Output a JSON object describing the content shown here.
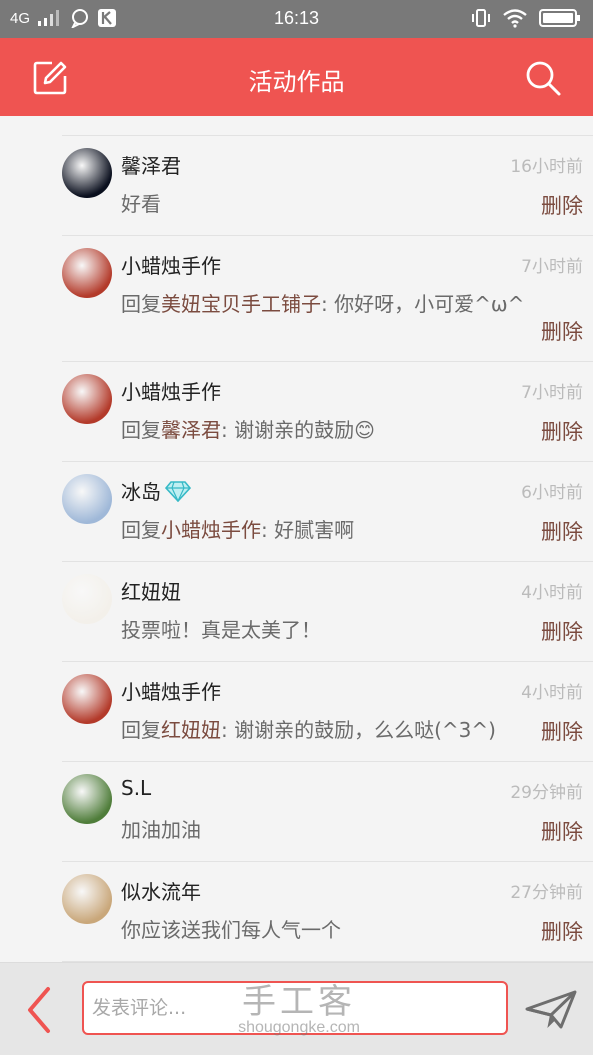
{
  "status_bar": {
    "network": "4G",
    "time": "16:13"
  },
  "header": {
    "title": "活动作品",
    "edit_icon": "edit-square-icon",
    "search_icon": "search-icon",
    "background": "#ef5451"
  },
  "comments": [
    {
      "name": "馨泽君",
      "badge": "",
      "time": "16小时前",
      "prefix": "",
      "mention": "",
      "text": "好看",
      "delete": "删除",
      "avatar_color": "#0a0f1e"
    },
    {
      "name": "小蜡烛手作",
      "badge": "",
      "time": "7小时前",
      "prefix": "回复",
      "mention": "美妞宝贝手工铺子",
      "text": ": 你好呀，小可爱^ω^",
      "delete": "删除",
      "avatar_color": "#b33a2a"
    },
    {
      "name": "小蜡烛手作",
      "badge": "",
      "time": "7小时前",
      "prefix": "回复",
      "mention": "馨泽君",
      "text": ": 谢谢亲的鼓励😊",
      "delete": "删除",
      "avatar_color": "#b33a2a"
    },
    {
      "name": "冰岛",
      "badge": "diamond-icon",
      "time": "6小时前",
      "prefix": "回复",
      "mention": "小蜡烛手作",
      "text": ": 好腻害啊",
      "delete": "删除",
      "avatar_color": "#9fb8d8"
    },
    {
      "name": "红妞妞",
      "badge": "",
      "time": "4小时前",
      "prefix": "",
      "mention": "",
      "text": "投票啦！真是太美了！",
      "delete": "删除",
      "avatar_color": "#f3f0ea"
    },
    {
      "name": "小蜡烛手作",
      "badge": "",
      "time": "4小时前",
      "prefix": "回复",
      "mention": "红妞妞",
      "text": ": 谢谢亲的鼓励，么么哒(^3^)",
      "delete": "删除",
      "avatar_color": "#b33a2a"
    },
    {
      "name": "S.L",
      "badge": "",
      "time": "29分钟前",
      "prefix": "",
      "mention": "",
      "text": "加油加油",
      "delete": "删除",
      "avatar_color": "#4f7d3a"
    },
    {
      "name": "似水流年",
      "badge": "",
      "time": "27分钟前",
      "prefix": "",
      "mention": "",
      "text": "你应该送我们每人气一个",
      "delete": "删除",
      "avatar_color": "#c9a77a"
    }
  ],
  "bottom_bar": {
    "back_icon": "chevron-left-icon",
    "placeholder": "发表评论...",
    "send_icon": "send-paper-plane-icon"
  },
  "watermark": {
    "main": "手工客",
    "sub": "shougongke.com"
  }
}
